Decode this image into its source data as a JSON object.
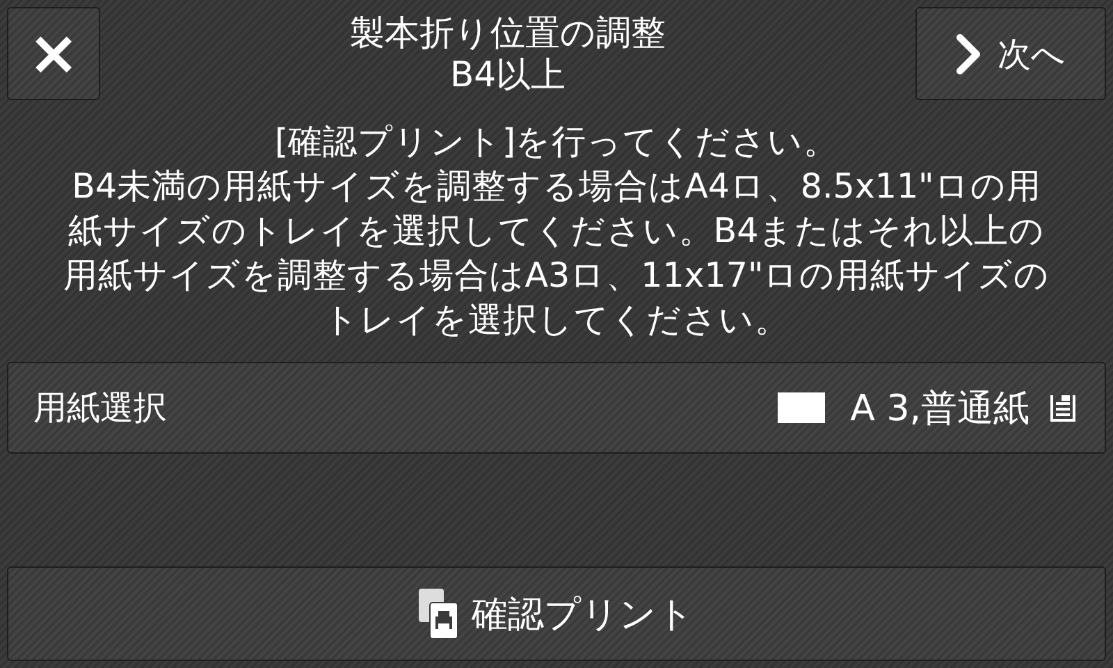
{
  "header": {
    "title": "製本折り位置の調整",
    "subtitle": "B4以上",
    "close_button": {
      "label": "×"
    },
    "next_button": {
      "label": "次へ"
    }
  },
  "message_lines": [
    "[確認プリント]を行ってください。",
    "B4未満の用紙サイズを調整する場合はA4ロ、8.5x11\"ロの用",
    "紙サイズのトレイを選択してください。B4またはそれ以上の",
    "用紙サイズを調整する場合はA3ロ、11x17\"ロの用紙サイズの",
    "トレイを選択してください。"
  ],
  "paper_select": {
    "label": "用紙選択",
    "value": "A 3,普通紙"
  },
  "print_button": {
    "label": "確認プリント"
  }
}
